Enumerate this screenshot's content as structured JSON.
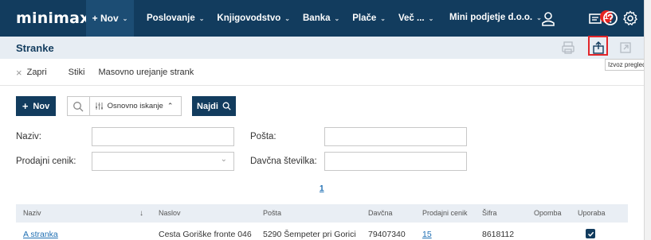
{
  "app": {
    "logo": "minimax",
    "new_menu": "+ Nov",
    "menus": [
      "Poslovanje",
      "Knjigovodstvo",
      "Banka",
      "Plače",
      "Več ..."
    ],
    "company": "Mini podjetje d.o.o.",
    "notification_count": "1",
    "icons": [
      "user-icon",
      "notifications-icon",
      "help-icon",
      "settings-icon"
    ]
  },
  "page": {
    "title": "Stranke",
    "export_tooltip": "Izvoz preglednic"
  },
  "subnav": {
    "close": "Zapri",
    "contacts": "Stiki",
    "mass_edit": "Masovno urejanje strank"
  },
  "toolbar": {
    "new_label": "Nov",
    "search_mode": "Osnovno iskanje",
    "find_label": "Najdi"
  },
  "filters": {
    "name_label": "Naziv:",
    "name_value": "",
    "post_label": "Pošta:",
    "post_value": "",
    "pricelist_label": "Prodajni cenik:",
    "pricelist_value": "",
    "tax_label": "Davčna številka:",
    "tax_value": ""
  },
  "pagination": {
    "current": "1"
  },
  "table": {
    "headers": [
      "Naziv",
      "Naslov",
      "Pošta",
      "Davčna",
      "Prodajni cenik",
      "Šifra",
      "Opomba",
      "Uporaba"
    ],
    "rows": [
      {
        "naziv": "A stranka",
        "naslov": "Cesta Goriške fronte 046",
        "posta": "5290 Šempeter pri Gorici",
        "davcna": "79407340",
        "cenik": "15",
        "sifra": "8618112",
        "opomba": "",
        "uporaba": true
      }
    ]
  },
  "colors": {
    "navy": "#123c5e",
    "link": "#1f6fb3",
    "highlight": "#e3262a",
    "badge": "#e52421"
  }
}
